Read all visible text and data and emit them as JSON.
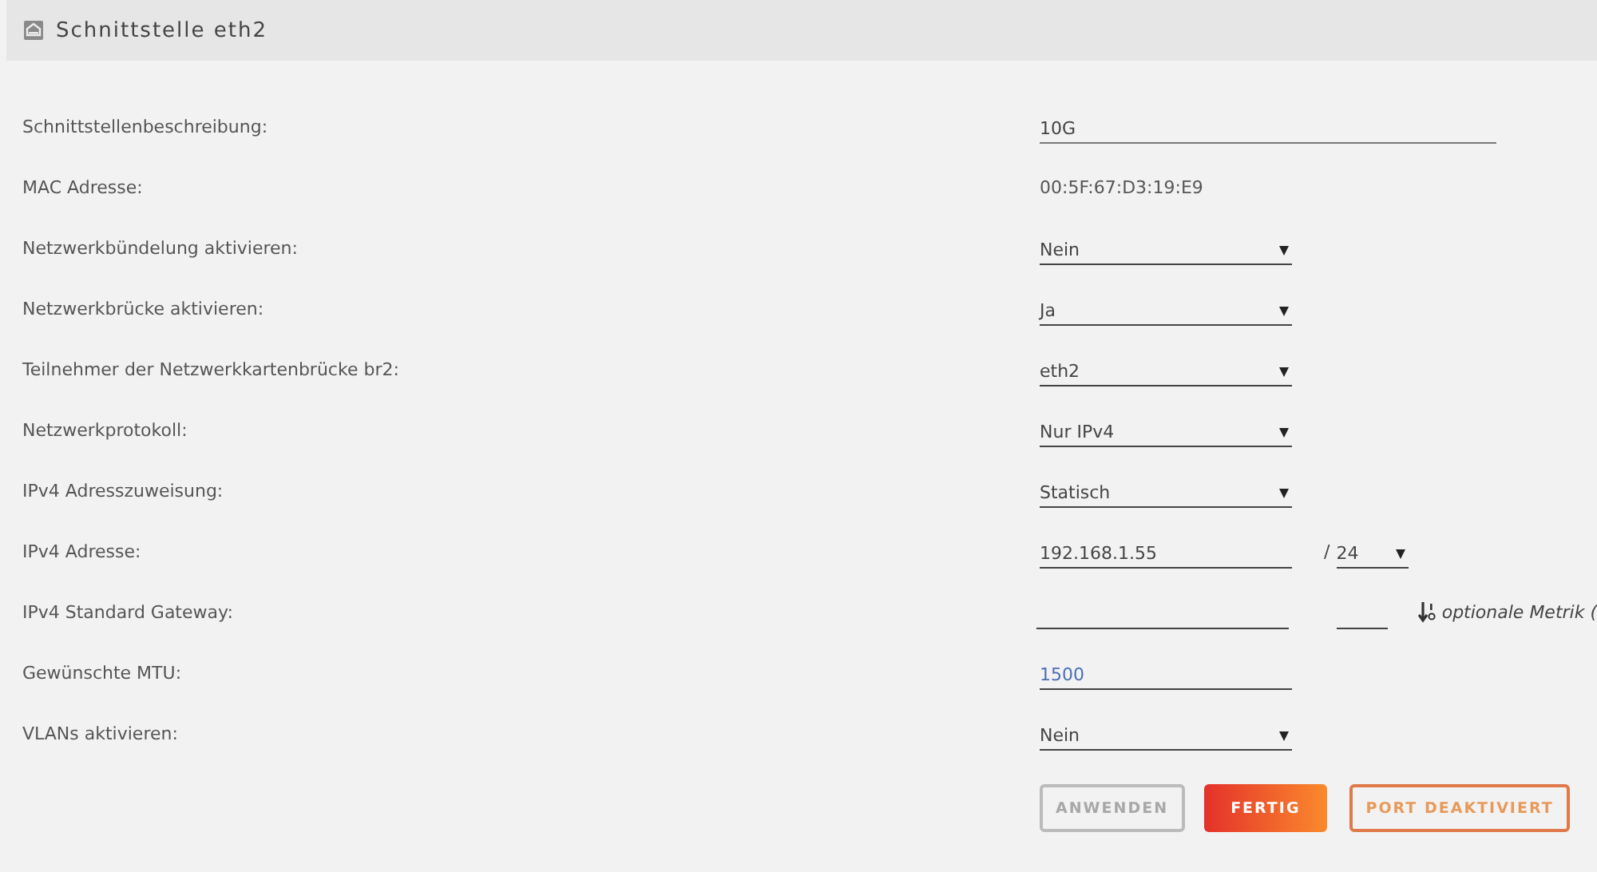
{
  "panel": {
    "title": "Schnittstelle eth2"
  },
  "rows": [
    {
      "kind": "input",
      "label": "Schnittstellenbeschreibung:",
      "value": "10G",
      "wide": true
    },
    {
      "kind": "static",
      "label": "MAC Adresse:",
      "value": "00:5F:67:D3:19:E9"
    },
    {
      "kind": "select",
      "label": "Netzwerkbündelung aktivieren:",
      "value": "Nein"
    },
    {
      "kind": "select",
      "label": "Netzwerkbrücke aktivieren:",
      "value": "Ja"
    },
    {
      "kind": "select",
      "label": "Teilnehmer der Netzwerkkartenbrücke br2:",
      "value": "eth2"
    },
    {
      "kind": "select",
      "label": "Netzwerkprotokoll:",
      "value": "Nur IPv4"
    },
    {
      "kind": "select",
      "label": "IPv4 Adresszuweisung:",
      "value": "Statisch"
    },
    {
      "kind": "ip",
      "label": "IPv4 Adresse:",
      "value": "192.168.1.55",
      "separator": "/",
      "prefix": "24"
    },
    {
      "kind": "gateway",
      "label": "IPv4 Standard Gateway:",
      "metric_hint": "optionale Metrik ("
    },
    {
      "kind": "input",
      "label": "Gewünschte MTU:",
      "placeholder": "1500"
    },
    {
      "kind": "select",
      "label": "VLANs aktivieren:",
      "value": "Nein"
    }
  ],
  "buttons": [
    {
      "label": "ANWENDEN",
      "kind": "outline",
      "disabled": true
    },
    {
      "label": "FERTIG",
      "kind": "primary",
      "disabled": false
    },
    {
      "label": "PORT DEAKTIVIERT",
      "kind": "warning",
      "disabled": false
    }
  ]
}
